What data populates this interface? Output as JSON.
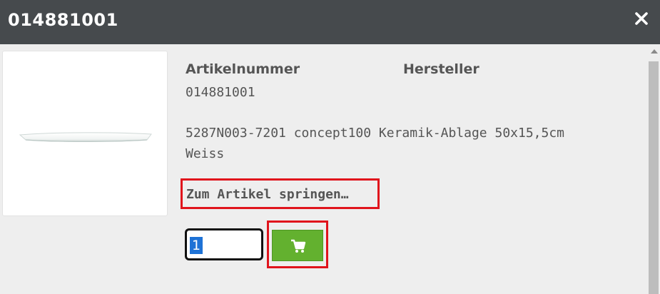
{
  "header": {
    "title": "014881001",
    "close_icon": "close-icon"
  },
  "product": {
    "image_alt": "ceramic shelf white",
    "article_number_label": "Artikelnummer",
    "manufacturer_label": "Hersteller",
    "article_number": "014881001",
    "description_line1": "5287N003-7201 concept100 Keramik-Ablage 50x15,5cm",
    "description_line2": "Weiss",
    "jump_link": "Zum Artikel springen…"
  },
  "order": {
    "quantity": "1",
    "cart_icon": "shopping-cart-icon",
    "accent_color": "#63b12f"
  },
  "highlight_color": "#e0141c"
}
